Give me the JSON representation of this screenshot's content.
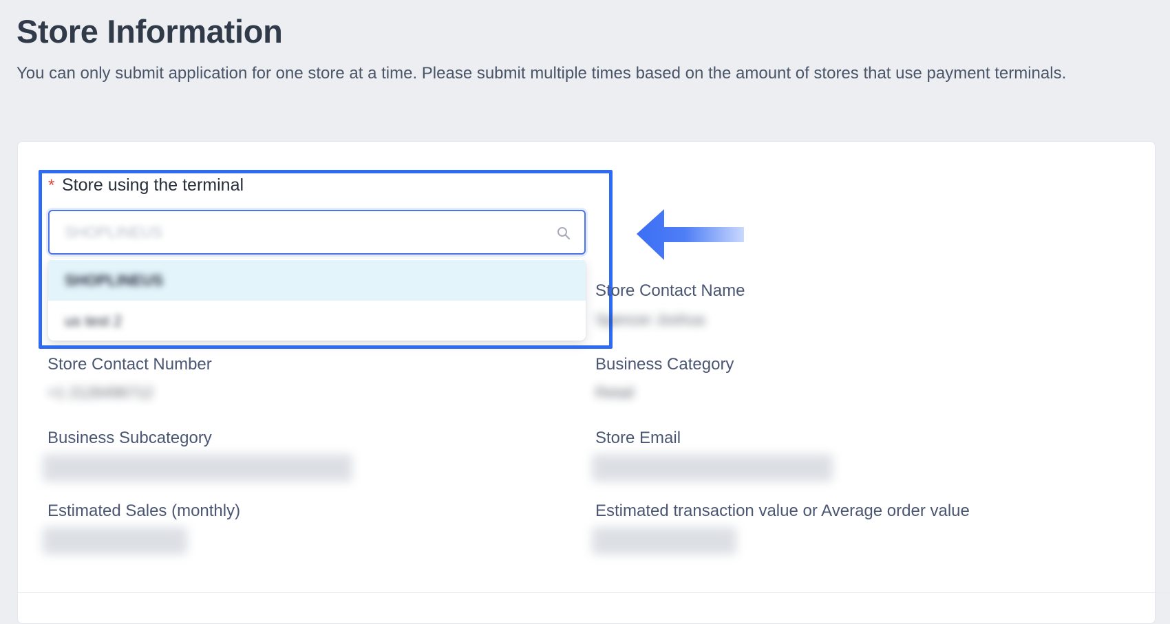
{
  "page": {
    "title": "Store Information",
    "description": "You can only submit application for one store at a time. Please submit multiple times based on the amount of stores that use payment terminals."
  },
  "store_select": {
    "required_mark": "*",
    "label": "Store using the terminal",
    "selected_value": "SHOPLINEUS",
    "icon": "search-icon",
    "options": [
      {
        "label": "SHOPLINEUS",
        "highlighted": true
      },
      {
        "label": "us test 2",
        "highlighted": false
      }
    ]
  },
  "fields": {
    "store_contact_name": {
      "label": "Store Contact Name",
      "value": "Spencer Joshua"
    },
    "store_contact_number": {
      "label": "Store Contact Number",
      "value": "+1 2126496712"
    },
    "business_category": {
      "label": "Business Category",
      "value": "Retail"
    },
    "business_subcategory": {
      "label": "Business Subcategory",
      "value": ""
    },
    "store_email": {
      "label": "Store Email",
      "value": ""
    },
    "estimated_sales": {
      "label": "Estimated Sales (monthly)",
      "value": ""
    },
    "estimated_transaction": {
      "label": "Estimated transaction value or Average order value",
      "value": ""
    }
  },
  "colors": {
    "highlight": "#2f6af5",
    "arrow": "#3b6ef5",
    "required": "#e2463c",
    "option_highlight": "#e3f4fb"
  }
}
